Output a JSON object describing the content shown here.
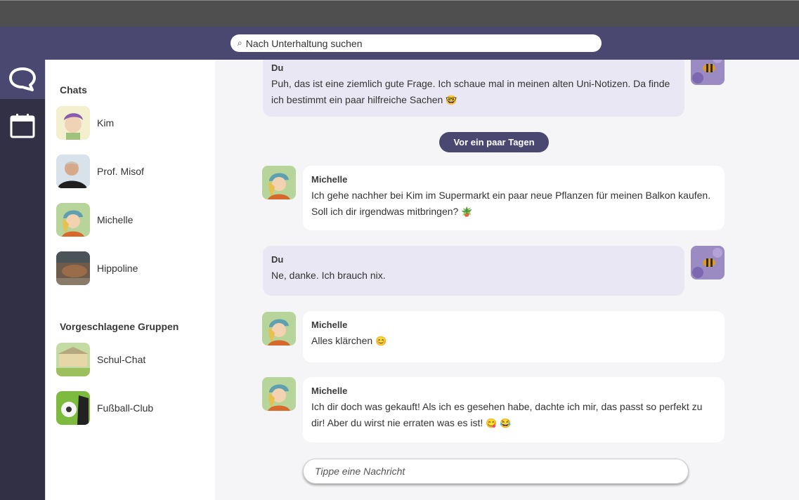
{
  "search": {
    "placeholder": "Nach Unterhaltung suchen",
    "icon": "search-icon"
  },
  "rail": {
    "items": [
      {
        "icon": "chat-bubble-icon",
        "active": true
      },
      {
        "icon": "calendar-icon",
        "active": false
      }
    ]
  },
  "sidebar": {
    "chats_title": "Chats",
    "chats": [
      {
        "name": "Kim",
        "icon": "avatar-kim"
      },
      {
        "name": "Prof. Misof",
        "icon": "avatar-prof-misof"
      },
      {
        "name": "Michelle",
        "icon": "avatar-michelle"
      },
      {
        "name": "Hippoline",
        "icon": "avatar-hippoline"
      }
    ],
    "groups_title": "Vorgeschlagene Gruppen",
    "groups": [
      {
        "name": "Schul-Chat",
        "icon": "avatar-school"
      },
      {
        "name": "Fußball-Club",
        "icon": "avatar-football"
      }
    ]
  },
  "messages": [
    {
      "sender": "Du",
      "text": "Puh, das ist eine ziemlich gute Frage. Ich schaue mal in meinen alten Uni-Notizen. Da finde ich bestimmt ein paar hilfreiche Sachen",
      "emoji": "🤓"
    },
    {
      "sender": "Michelle",
      "text": "Ich gehe nachher bei Kim im Supermarkt ein paar neue Pflanzen für meinen Balkon kaufen. Soll ich dir irgendwas mitbringen?",
      "emoji": "🪴"
    },
    {
      "sender": "Du",
      "text": "Ne, danke. Ich brauch nix.",
      "emoji": ""
    },
    {
      "sender": "Michelle",
      "text": "Alles klärchen",
      "emoji": "😊"
    },
    {
      "sender": "Michelle",
      "text": "Ich dir doch was gekauft! Als ich es gesehen habe, dachte ich mir, das passt so perfekt zu dir!  Aber du wirst nie erraten was es ist!",
      "emoji": "😋 😂"
    }
  ],
  "date_divider": "Vor ein paar Tagen",
  "composer": {
    "placeholder": "Tippe eine Nachricht"
  },
  "colors": {
    "accent": "#4a4870",
    "rail": "#313044",
    "own_bubble": "#e8e7f3"
  }
}
